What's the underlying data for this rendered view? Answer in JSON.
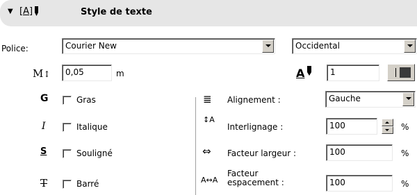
{
  "header": {
    "title": "Style de texte"
  },
  "police": {
    "label": "Police:",
    "font": "Courier New",
    "script": "Occidental"
  },
  "size": {
    "value": "0,05",
    "unit": "m"
  },
  "pen": {
    "value": "1"
  },
  "styles": {
    "bold": "Gras",
    "italic": "Italique",
    "underline": "Souligné",
    "strike": "Barré"
  },
  "alignment": {
    "label": "Alignement :",
    "value": "Gauche"
  },
  "line_spacing": {
    "label": "Interlignage :",
    "value": "100",
    "unit": "%"
  },
  "width_factor": {
    "label": "Facteur largeur :",
    "value": "100",
    "unit": "%"
  },
  "spacing_factor": {
    "label_line1": "Facteur",
    "label_line2": "espacement :",
    "value": "100",
    "unit": "%"
  },
  "icons": {
    "collapse": "▼",
    "text_style": "[A]",
    "size": "M",
    "size_arrows": "↕",
    "pen": "A",
    "bold": "G",
    "italic": "I",
    "underline": "S",
    "strike": "T",
    "align": "≣",
    "line_spacing": "↕A",
    "width": "⇔",
    "spacing": "A↔A"
  }
}
